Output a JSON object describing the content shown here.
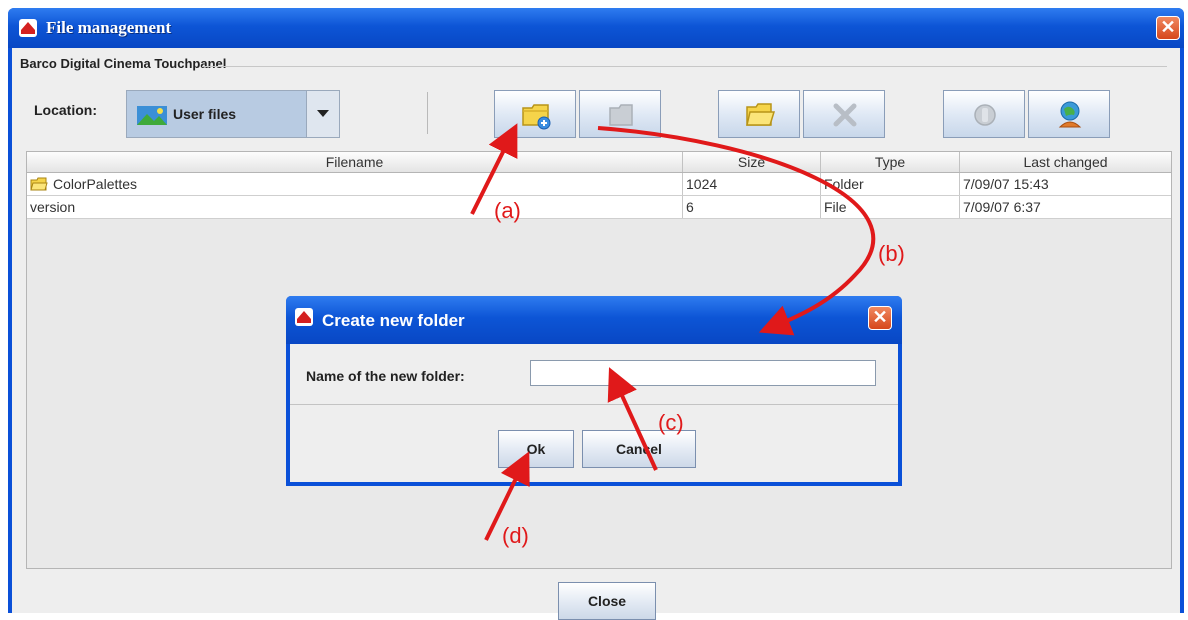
{
  "window": {
    "title": "File management",
    "group_title": "Barco Digital Cinema Touchpanel",
    "close_glyph": "✕"
  },
  "location": {
    "label": "Location:",
    "value": "User files"
  },
  "toolbar": {
    "buttons": [
      {
        "icon": "new-folder-icon",
        "enabled": true
      },
      {
        "icon": "rename-icon",
        "enabled": false
      },
      {
        "icon": "open-folder-icon",
        "enabled": true
      },
      {
        "icon": "delete-icon",
        "enabled": false
      },
      {
        "icon": "disconnect-icon",
        "enabled": false
      },
      {
        "icon": "user-profile-icon",
        "enabled": true
      }
    ]
  },
  "table": {
    "columns": [
      "Filename",
      "Size",
      "Type",
      "Last changed"
    ],
    "rows": [
      {
        "name": "ColorPalettes",
        "size": "1024",
        "type": "Folder",
        "changed": "7/09/07 15:43",
        "icon": "folder-icon"
      },
      {
        "name": "version",
        "size": "6",
        "type": "File",
        "changed": "7/09/07 6:37",
        "icon": ""
      }
    ]
  },
  "dialog": {
    "title": "Create new folder",
    "field_label": "Name of the new folder:",
    "field_value": "",
    "ok_label": "Ok",
    "cancel_label": "Cancel",
    "close_glyph": "✕"
  },
  "footer": {
    "close_label": "Close"
  },
  "annotations": {
    "a": "(a)",
    "b": "(b)",
    "c": "(c)",
    "d": "(d)",
    "color": "#e0191a"
  },
  "colors": {
    "titlebar": "#0d55d6",
    "window_bg": "#eeeeee",
    "annotation": "#e0191a"
  }
}
